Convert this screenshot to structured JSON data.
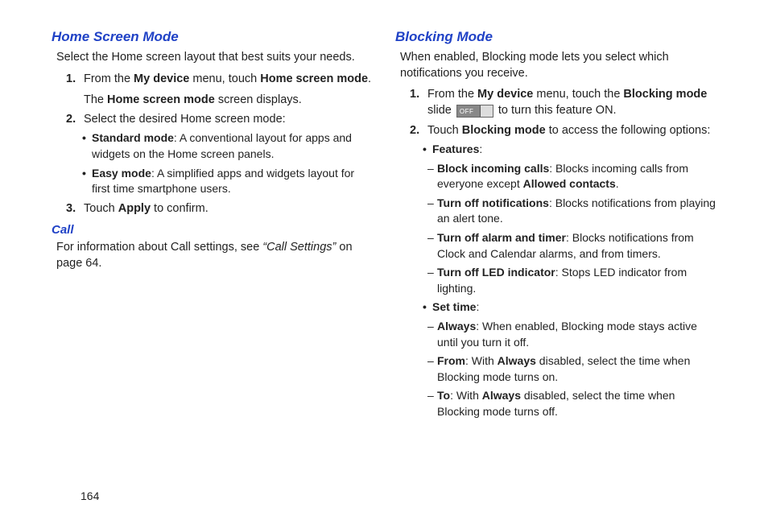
{
  "page_number": "164",
  "left": {
    "h_home": "Home Screen Mode",
    "p_home_intro": "Select the Home screen layout that best suits your needs.",
    "s1_num": "1.",
    "s1_a": "From the ",
    "s1_b": "My device",
    "s1_c": " menu, touch ",
    "s1_d": "Home screen mode",
    "s1_e": ".",
    "s1_line2_a": "The ",
    "s1_line2_b": "Home screen mode",
    "s1_line2_c": " screen displays.",
    "s2_num": "2.",
    "s2_text": "Select the desired Home screen mode:",
    "b1_a": "Standard mode",
    "b1_b": ": A conventional layout for apps and widgets on the Home screen panels.",
    "b2_a": "Easy mode",
    "b2_b": ": A simplified apps and widgets layout for first time smartphone users.",
    "s3_num": "3.",
    "s3_a": "Touch ",
    "s3_b": "Apply",
    "s3_c": " to confirm.",
    "h_call": "Call",
    "p_call_a": "For information about Call settings, see ",
    "p_call_b": "“Call Settings”",
    "p_call_c": " on page 64."
  },
  "right": {
    "h_block": "Blocking Mode",
    "p_block": "When enabled, Blocking mode lets you select which notifications you receive.",
    "s1_num": "1.",
    "s1_a": "From the ",
    "s1_b": "My device",
    "s1_c": " menu, touch the ",
    "s1_d": "Blocking mode",
    "s1_e": " slide ",
    "s1_f": " to turn this feature ON.",
    "off_label": "OFF",
    "s2_num": "2.",
    "s2_a": "Touch ",
    "s2_b": "Blocking mode",
    "s2_c": " to access the following options:",
    "b_feat_a": "Features",
    "b_feat_b": ":",
    "d1_a": "Block incoming calls",
    "d1_b": ": Blocks incoming calls from everyone except ",
    "d1_c": "Allowed contacts",
    "d1_d": ".",
    "d2_a": "Turn off notifications",
    "d2_b": ": Blocks notifications from playing an alert tone.",
    "d3_a": "Turn off alarm and timer",
    "d3_b": ": Blocks notifications from Clock and Calendar alarms, and from timers.",
    "d4_a": "Turn off LED indicator",
    "d4_b": ": Stops LED indicator from lighting.",
    "b_set_a": "Set time",
    "b_set_b": ":",
    "d5_a": "Always",
    "d5_b": ": When enabled, Blocking mode stays active until you turn it off.",
    "d6_a": "From",
    "d6_b": ": With ",
    "d6_c": "Always",
    "d6_d": " disabled, select the time when Blocking mode turns on.",
    "d7_a": "To",
    "d7_b": ": With ",
    "d7_c": "Always",
    "d7_d": " disabled, select the time when Blocking mode turns off."
  }
}
